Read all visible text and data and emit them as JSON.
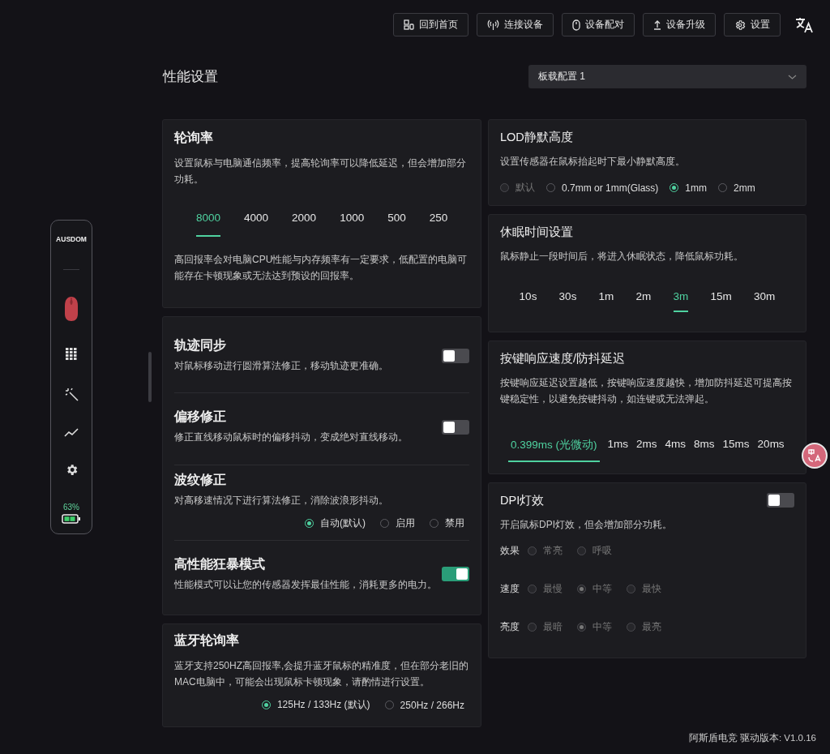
{
  "topbar": {
    "buttons": [
      {
        "label": "回到首页",
        "kind": "home"
      },
      {
        "label": "连接设备",
        "kind": "connect"
      },
      {
        "label": "设备配对",
        "kind": "pair"
      },
      {
        "label": "设备升级",
        "kind": "upgrade"
      },
      {
        "label": "设置",
        "kind": "settings"
      }
    ]
  },
  "sidebar": {
    "logo": "AUSDOM",
    "items": [
      {
        "kind": "keys"
      },
      {
        "kind": "magic"
      },
      {
        "kind": "chart"
      },
      {
        "kind": "settings"
      }
    ],
    "battery": "63%"
  },
  "page_title": "性能设置",
  "profile_select": {
    "value": "板载配置 1"
  },
  "polling_rate": {
    "title": "轮询率",
    "description": "设置鼠标与电脑通信频率，提高轮询率可以降低延迟，但会增加部分功耗。",
    "options": [
      {
        "label": "8000",
        "selected": true
      },
      {
        "label": "4000",
        "selected": false
      },
      {
        "label": "2000",
        "selected": false
      },
      {
        "label": "1000",
        "selected": false
      },
      {
        "label": "500",
        "selected": false
      },
      {
        "label": "250",
        "selected": false
      }
    ],
    "note": "高回报率会对电脑CPU性能与内存频率有一定要求，低配置的电脑可能存在卡顿现象或无法达到预设的回报率。"
  },
  "motion_settings": [
    {
      "kind": "toggle",
      "title": "轨迹同步",
      "description": "对鼠标移动进行圆滑算法修正，移动轨迹更准确。",
      "on": false
    },
    {
      "kind": "toggle",
      "title": "偏移修正",
      "description": "修正直线移动鼠标时的偏移抖动，变成绝对直线移动。",
      "on": false
    },
    {
      "kind": "radio",
      "title": "波纹修正",
      "description": "对高移速情况下进行算法修正，消除波浪形抖动。",
      "options": [
        {
          "label": "自动(默认)",
          "selected": true
        },
        {
          "label": "启用",
          "selected": false
        },
        {
          "label": "禁用",
          "selected": false
        }
      ]
    },
    {
      "kind": "toggle",
      "title": "高性能狂暴模式",
      "description": "性能模式可以让您的传感器发挥最佳性能，消耗更多的电力。",
      "on": true
    }
  ],
  "bluetooth_polling": {
    "title": "蓝牙轮询率",
    "description": "蓝牙支持250HZ高回报率,会提升蓝牙鼠标的精准度，但在部分老旧的MAC电脑中，可能会出现鼠标卡顿现象，请酌情进行设置。",
    "options": [
      {
        "label": "125Hz / 133Hz (默认)",
        "selected": true
      },
      {
        "label": "250Hz / 266Hz",
        "selected": false
      }
    ]
  },
  "lod": {
    "title": "LOD静默高度",
    "description": "设置传感器在鼠标抬起时下最小静默高度。",
    "options": [
      {
        "label": "默认",
        "selected": false,
        "disabled": true
      },
      {
        "label": "0.7mm or 1mm(Glass)",
        "selected": false,
        "disabled": false
      },
      {
        "label": "1mm",
        "selected": true,
        "disabled": false
      },
      {
        "label": "2mm",
        "selected": false,
        "disabled": false
      }
    ]
  },
  "sleep": {
    "title": "休眠时间设置",
    "description": "鼠标静止一段时间后，将进入休眠状态，降低鼠标功耗。",
    "options": [
      {
        "label": "10s",
        "selected": false
      },
      {
        "label": "30s",
        "selected": false
      },
      {
        "label": "1m",
        "selected": false
      },
      {
        "label": "2m",
        "selected": false
      },
      {
        "label": "3m",
        "selected": true
      },
      {
        "label": "15m",
        "selected": false
      },
      {
        "label": "30m",
        "selected": false
      }
    ]
  },
  "debounce": {
    "title": "按键响应速度/防抖延迟",
    "description": "按键响应延迟设置越低，按键响应速度越快，增加防抖延迟可提高按键稳定性，以避免按键抖动，如连键或无法弹起。",
    "options": [
      {
        "label": "0.399ms (光微动)",
        "selected": true
      },
      {
        "label": "1ms",
        "selected": false
      },
      {
        "label": "2ms",
        "selected": false
      },
      {
        "label": "4ms",
        "selected": false
      },
      {
        "label": "8ms",
        "selected": false
      },
      {
        "label": "15ms",
        "selected": false
      },
      {
        "label": "20ms",
        "selected": false
      }
    ]
  },
  "dpi_light": {
    "title": "DPI灯效",
    "on": false,
    "description": "开启鼠标DPI灯效，但会增加部分功耗。",
    "rows": [
      {
        "label": "效果",
        "options": [
          {
            "label": "常亮",
            "selected": false
          },
          {
            "label": "呼吸",
            "selected": false
          }
        ]
      },
      {
        "label": "速度",
        "options": [
          {
            "label": "最慢",
            "selected": false
          },
          {
            "label": "中等",
            "selected": true
          },
          {
            "label": "最快",
            "selected": false
          }
        ]
      },
      {
        "label": "亮度",
        "options": [
          {
            "label": "最暗",
            "selected": false
          },
          {
            "label": "中等",
            "selected": true
          },
          {
            "label": "最亮",
            "selected": false
          }
        ]
      }
    ]
  },
  "footer": "阿斯盾电竞 驱动版本: V1.0.16"
}
